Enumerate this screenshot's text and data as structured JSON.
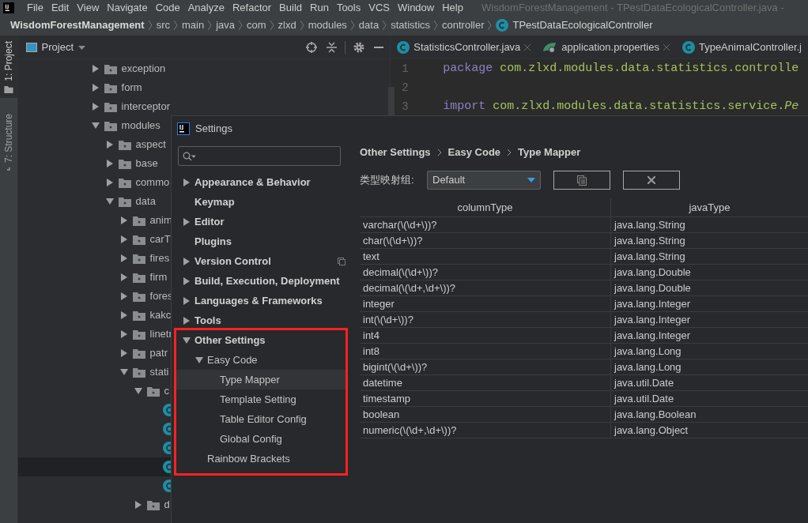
{
  "menu_bar": {
    "items": [
      "File",
      "Edit",
      "View",
      "Navigate",
      "Code",
      "Analyze",
      "Refactor",
      "Build",
      "Run",
      "Tools",
      "VCS",
      "Window",
      "Help"
    ],
    "window_title": "WisdomForestManagement - TPestDataEcologicalController.java -"
  },
  "breadcrumb": [
    {
      "label": "WisdomForestManagement",
      "kind": "project"
    },
    {
      "label": "src",
      "kind": "folder"
    },
    {
      "label": "main",
      "kind": "folder"
    },
    {
      "label": "java",
      "kind": "folder"
    },
    {
      "label": "com",
      "kind": "folder"
    },
    {
      "label": "zlxd",
      "kind": "folder"
    },
    {
      "label": "modules",
      "kind": "folder"
    },
    {
      "label": "data",
      "kind": "folder"
    },
    {
      "label": "statistics",
      "kind": "folder"
    },
    {
      "label": "controller",
      "kind": "folder"
    },
    {
      "label": "TPestDataEcologicalController",
      "kind": "class"
    }
  ],
  "tool_strip": [
    {
      "label": "1: Project",
      "kind": "project",
      "selected": true
    },
    {
      "label": "7: Structure",
      "kind": "structure",
      "selected": false
    }
  ],
  "project_panel": {
    "title": "Project",
    "tree": [
      {
        "label": "exception",
        "kind": "folder",
        "expanded": false,
        "selected": false
      },
      {
        "label": "form",
        "kind": "folder",
        "expanded": false,
        "selected": false
      },
      {
        "label": "interceptor",
        "kind": "folder",
        "expanded": false,
        "selected": false
      },
      {
        "label": "modules",
        "kind": "folder",
        "expanded": true,
        "selected": false,
        "children": [
          {
            "label": "aspect",
            "kind": "folder",
            "expanded": false,
            "selected": false
          },
          {
            "label": "base",
            "kind": "folder",
            "expanded": false,
            "selected": false
          },
          {
            "label": "commo",
            "kind": "folder",
            "expanded": false,
            "selected": false
          },
          {
            "label": "data",
            "kind": "folder",
            "expanded": true,
            "selected": false,
            "children": [
              {
                "label": "anim",
                "kind": "folder",
                "expanded": false,
                "selected": false
              },
              {
                "label": "carT",
                "kind": "folder",
                "expanded": false,
                "selected": false
              },
              {
                "label": "fires",
                "kind": "folder",
                "expanded": false,
                "selected": false
              },
              {
                "label": "firm",
                "kind": "folder",
                "expanded": false,
                "selected": false
              },
              {
                "label": "fores",
                "kind": "folder",
                "expanded": false,
                "selected": false
              },
              {
                "label": "kakc",
                "kind": "folder",
                "expanded": false,
                "selected": false
              },
              {
                "label": "linetr",
                "kind": "folder",
                "expanded": false,
                "selected": false
              },
              {
                "label": "patr",
                "kind": "folder",
                "expanded": false,
                "selected": false
              },
              {
                "label": "stati",
                "kind": "folder",
                "expanded": true,
                "selected": false,
                "children": [
                  {
                    "label": "c",
                    "kind": "folder",
                    "expanded": true,
                    "selected": false,
                    "children": [
                      {
                        "kind": "class",
                        "selected": false
                      },
                      {
                        "kind": "class",
                        "selected": false
                      },
                      {
                        "kind": "class",
                        "selected": false
                      },
                      {
                        "kind": "class",
                        "selected": true
                      },
                      {
                        "kind": "class",
                        "selected": false
                      }
                    ]
                  },
                  {
                    "label": "d",
                    "kind": "folder",
                    "expanded": false,
                    "selected": false
                  }
                ]
              }
            ]
          }
        ]
      }
    ]
  },
  "editor": {
    "tabs": [
      {
        "label": "StatisticsController.java",
        "kind": "class",
        "closable": true
      },
      {
        "label": "application.properties",
        "kind": "properties",
        "closable": true
      },
      {
        "label": "TypeAnimalController.j",
        "kind": "class",
        "closable": false
      }
    ],
    "lines": [
      {
        "number": "1",
        "tokens": [
          {
            "text": "package",
            "kind": "keyword"
          },
          {
            "text": " com.zlxd.modules.data.statistics.controlle",
            "kind": "name"
          }
        ]
      },
      {
        "number": "2"
      },
      {
        "number": "3",
        "tokens": [
          {
            "text": "import",
            "kind": "keyword"
          },
          {
            "text": " com.zlxd.modules.data.statistics.service.",
            "kind": "name"
          },
          {
            "text": "Pe",
            "kind": "italic"
          }
        ]
      }
    ]
  },
  "settings_dialog": {
    "title": "Settings",
    "nav": [
      {
        "label": "Appearance & Behavior",
        "kind": "group",
        "expanded": false,
        "selected": false,
        "project_level": false
      },
      {
        "label": "Keymap",
        "kind": "page",
        "selected": false,
        "project_level": false
      },
      {
        "label": "Editor",
        "kind": "group",
        "expanded": false,
        "selected": false,
        "project_level": false
      },
      {
        "label": "Plugins",
        "kind": "page",
        "selected": false,
        "project_level": false
      },
      {
        "label": "Version Control",
        "kind": "group",
        "expanded": false,
        "selected": false,
        "project_level": true
      },
      {
        "label": "Build, Execution, Deployment",
        "kind": "group",
        "expanded": false,
        "selected": false,
        "project_level": false
      },
      {
        "label": "Languages & Frameworks",
        "kind": "group",
        "expanded": false,
        "selected": false,
        "project_level": false
      },
      {
        "label": "Tools",
        "kind": "group",
        "expanded": false,
        "selected": false,
        "project_level": false
      },
      {
        "label": "Other Settings",
        "kind": "group",
        "expanded": true,
        "selected": false,
        "project_level": false,
        "children": [
          {
            "label": "Easy Code",
            "kind": "group",
            "expanded": true,
            "selected": false,
            "project_level": false,
            "children": [
              {
                "label": "Type Mapper",
                "kind": "page",
                "selected": true,
                "project_level": false
              },
              {
                "label": "Template Setting",
                "kind": "page",
                "selected": false,
                "project_level": false
              },
              {
                "label": "Table Editor Config",
                "kind": "page",
                "selected": false,
                "project_level": false
              },
              {
                "label": "Global Config",
                "kind": "page",
                "selected": false,
                "project_level": false
              }
            ]
          },
          {
            "label": "Rainbow Brackets",
            "kind": "page",
            "selected": false,
            "project_level": false
          }
        ]
      }
    ],
    "content": {
      "breadcrumb": [
        "Other Settings",
        "Easy Code",
        "Type Mapper"
      ],
      "group_label": "类型映射组:",
      "group_select": "Default",
      "buttons": [
        {
          "kind": "copy"
        },
        {
          "kind": "delete"
        }
      ],
      "table": {
        "columns": [
          "columnType",
          "javaType"
        ],
        "rows": [
          [
            "varchar(\\(\\d+\\))?",
            "java.lang.String"
          ],
          [
            "char(\\(\\d+\\))?",
            "java.lang.String"
          ],
          [
            "text",
            "java.lang.String"
          ],
          [
            "decimal(\\(\\d+\\))?",
            "java.lang.Double"
          ],
          [
            "decimal(\\(\\d+,\\d+\\))?",
            "java.lang.Double"
          ],
          [
            "integer",
            "java.lang.Integer"
          ],
          [
            "int(\\(\\d+\\))?",
            "java.lang.Integer"
          ],
          [
            "int4",
            "java.lang.Integer"
          ],
          [
            "int8",
            "java.lang.Long"
          ],
          [
            "bigint(\\(\\d+\\))?",
            "java.lang.Long"
          ],
          [
            "datetime",
            "java.util.Date"
          ],
          [
            "timestamp",
            "java.util.Date"
          ],
          [
            "boolean",
            "java.lang.Boolean"
          ],
          [
            "numeric(\\(\\d+,\\d+\\))?",
            "java.lang.Object"
          ]
        ]
      }
    }
  }
}
